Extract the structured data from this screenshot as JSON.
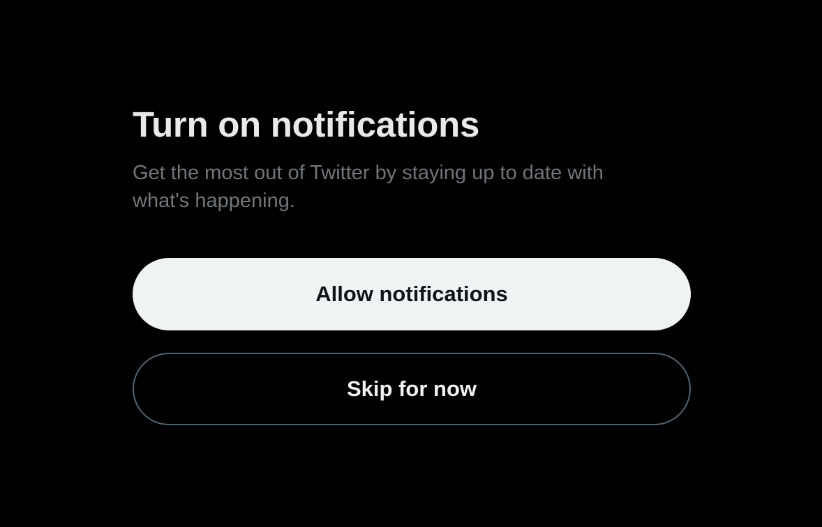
{
  "dialog": {
    "title": "Turn on notifications",
    "description": "Get the most out of Twitter by staying up to date with what's happening."
  },
  "actions": {
    "allow_label": "Allow notifications",
    "skip_label": "Skip for now"
  },
  "colors": {
    "background": "#000000",
    "title": "#e7e9ea",
    "description": "#71767b",
    "primary_button_bg": "#eff3f4",
    "primary_button_text": "#0f1419",
    "secondary_button_border": "#536471",
    "secondary_button_text": "#eff3f4"
  }
}
